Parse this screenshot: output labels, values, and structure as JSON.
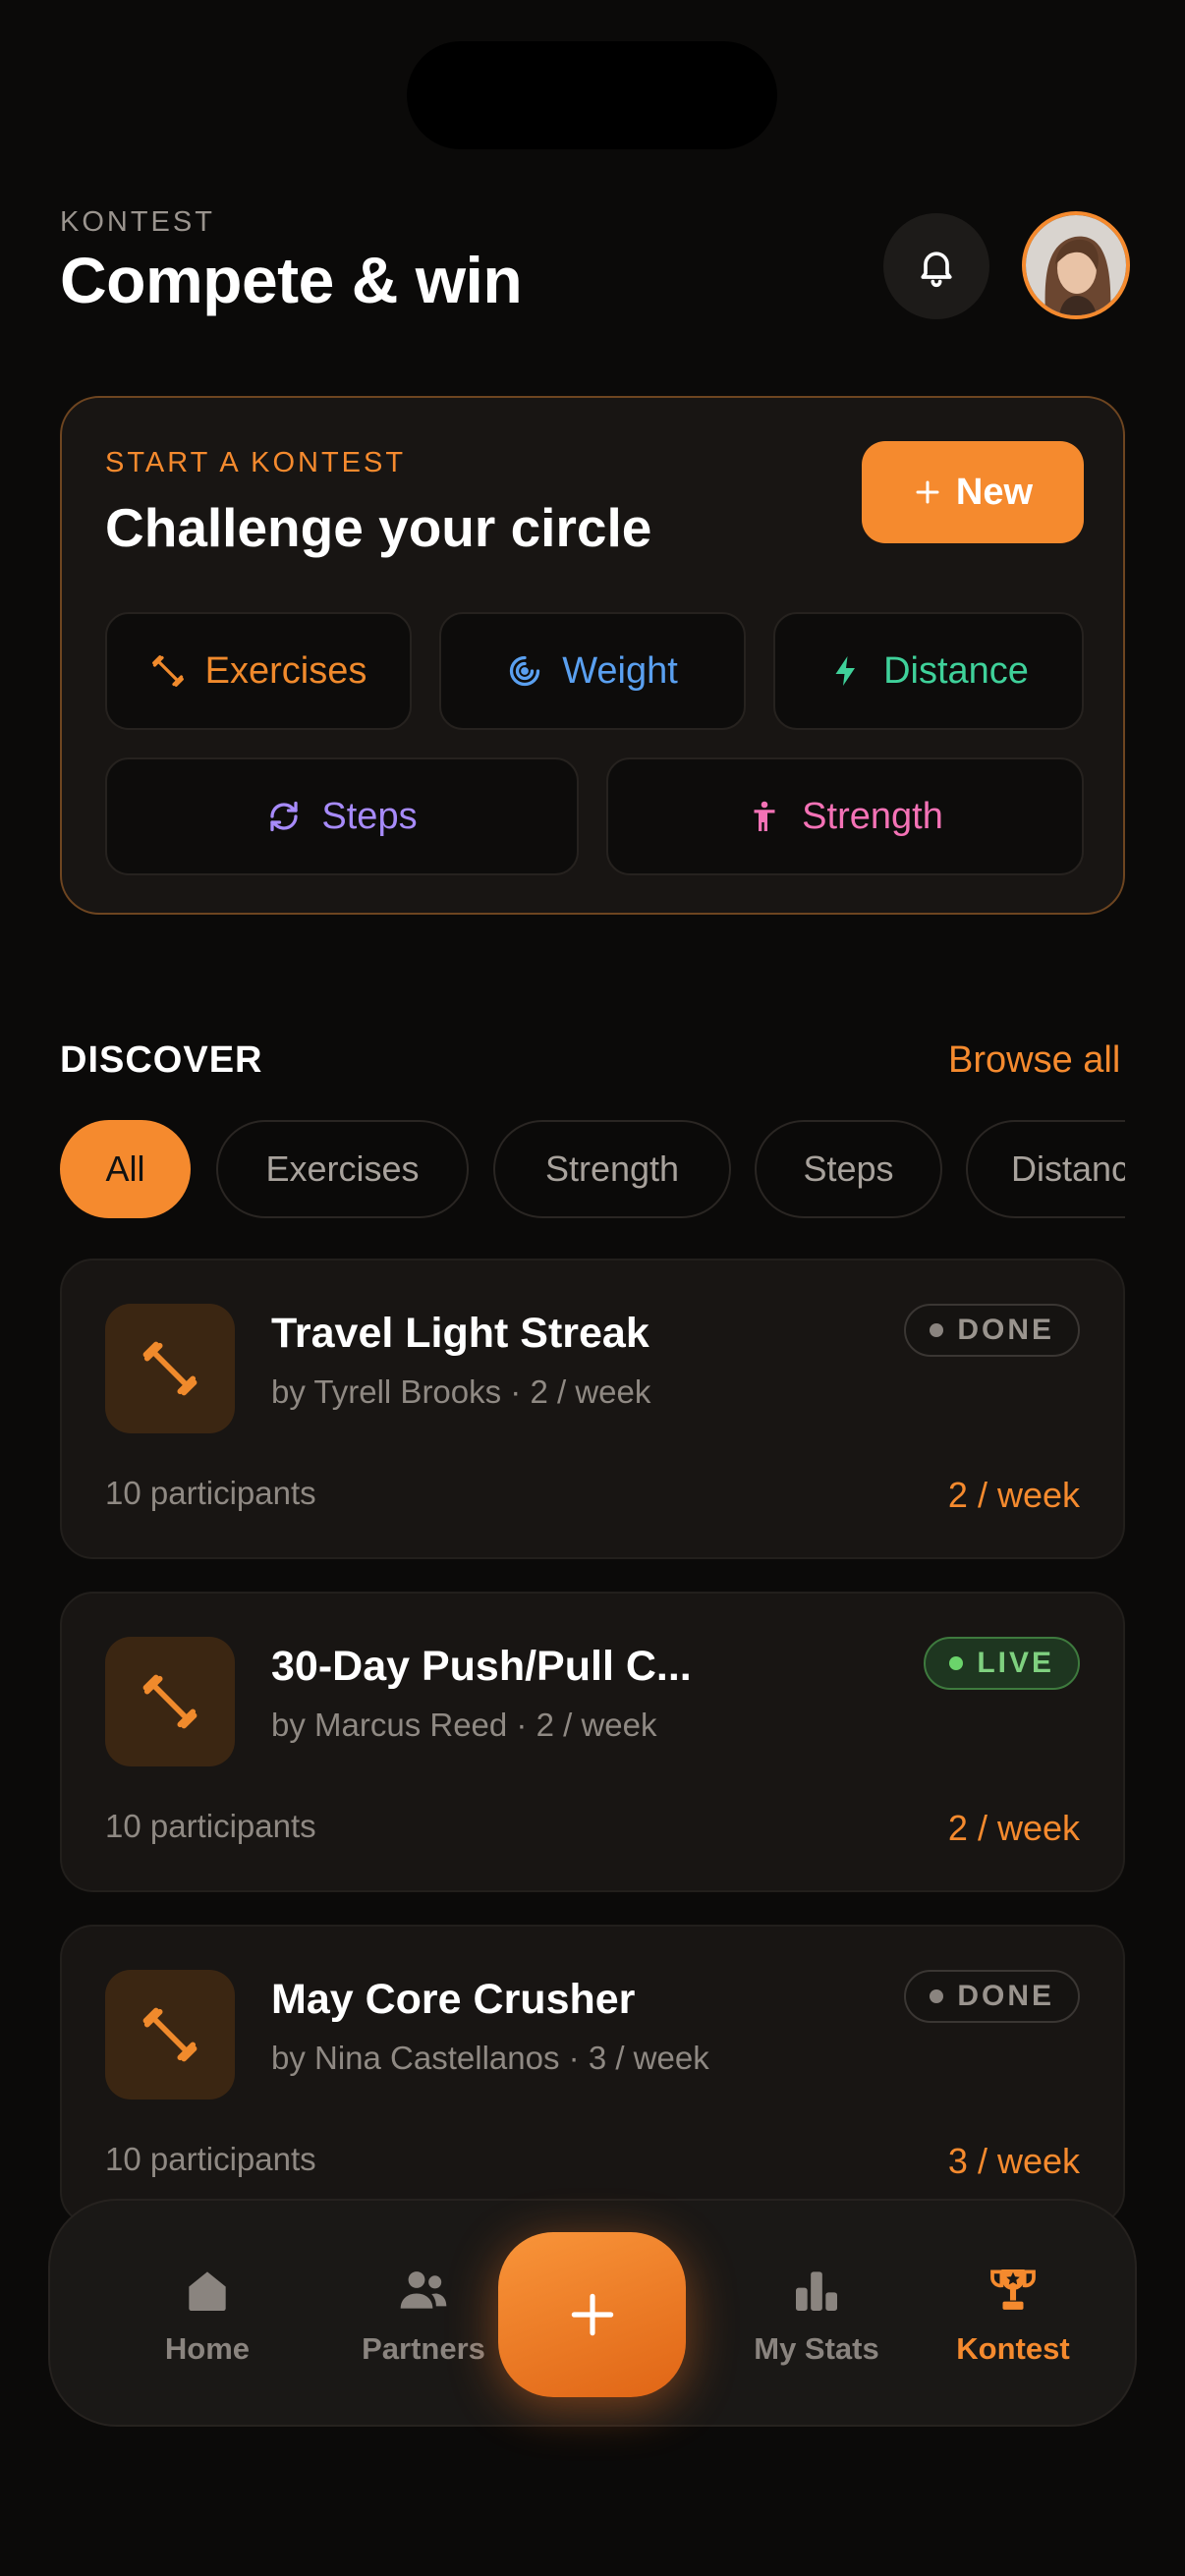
{
  "header": {
    "eyebrow": "KONTEST",
    "title": "Compete & win"
  },
  "start": {
    "eyebrow": "START A KONTEST",
    "title": "Challenge your circle",
    "new_label": "New",
    "categories": [
      {
        "label": "Exercises",
        "icon": "dumbbell-icon",
        "color": "#f08a2c"
      },
      {
        "label": "Weight",
        "icon": "target-icon",
        "color": "#5aa0f0"
      },
      {
        "label": "Distance",
        "icon": "bolt-icon",
        "color": "#3fd19a"
      },
      {
        "label": "Steps",
        "icon": "refresh-icon",
        "color": "#a78bfa"
      },
      {
        "label": "Strength",
        "icon": "person-icon",
        "color": "#f472b6"
      }
    ]
  },
  "discover": {
    "title": "DISCOVER",
    "browse_all": "Browse all",
    "filters": [
      "All",
      "Exercises",
      "Strength",
      "Steps",
      "Distance"
    ]
  },
  "contests": [
    {
      "name": "Travel Light Streak",
      "byline": "by Tyrell Brooks · 2 / week",
      "participants": "10 participants",
      "frequency": "2 / week",
      "status": "DONE"
    },
    {
      "name": "30-Day Push/Pull C...",
      "byline": "by Marcus Reed · 2 / week",
      "participants": "10 participants",
      "frequency": "2 / week",
      "status": "LIVE"
    },
    {
      "name": "May Core Crusher",
      "byline": "by Nina Castellanos · 3 / week",
      "participants": "10 participants",
      "frequency": "3 / week",
      "status": "DONE"
    }
  ],
  "nav": {
    "items": [
      "Home",
      "Partners",
      "My Stats",
      "Kontest"
    ],
    "active": "Kontest"
  },
  "colors": {
    "accent": "#f58a2e",
    "background": "#0b0a09",
    "card": "#181513",
    "live": "#6bd46b"
  }
}
